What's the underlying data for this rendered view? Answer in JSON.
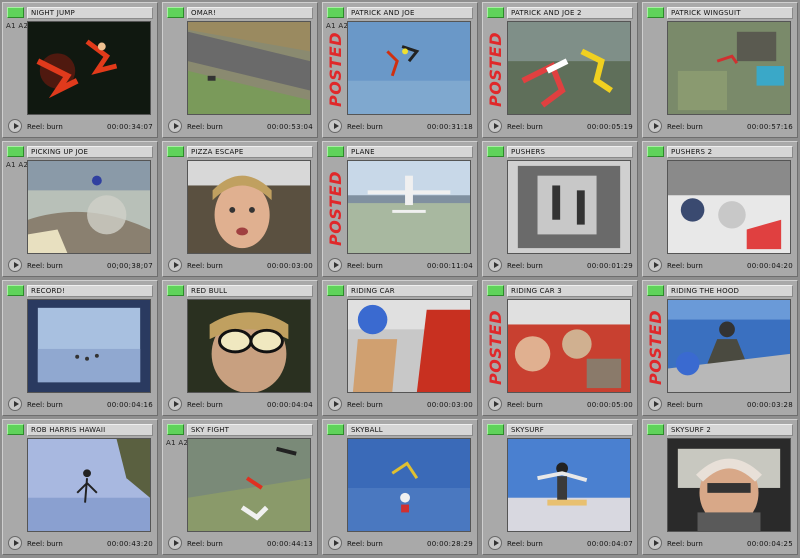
{
  "colors": {
    "background": "#8e8e8e",
    "tile": "#a9a9a9",
    "label_swatch": "#5fd35a",
    "posted_text": "#e0282a"
  },
  "clips": [
    {
      "name": "NIGHT JUMP",
      "tracks": "A1 A2",
      "posted": false,
      "reel": "Reel: burn",
      "timecode": "00:00:34:07",
      "scene": "night"
    },
    {
      "name": "OMAR!",
      "tracks": "",
      "posted": false,
      "reel": "Reel: burn",
      "timecode": "00:00:53:04",
      "scene": "road"
    },
    {
      "name": "PATRICK AND JOE",
      "tracks": "A1 A2",
      "posted": true,
      "reel": "Reel: burn",
      "timecode": "00:00:31:18",
      "scene": "sky"
    },
    {
      "name": "PATRICK AND JOE 2",
      "tracks": "",
      "posted": true,
      "reel": "Reel: burn",
      "timecode": "00:00:05:19",
      "scene": "aerial"
    },
    {
      "name": "PATRICK WINGSUIT",
      "tracks": "",
      "posted": false,
      "reel": "Reel: burn",
      "timecode": "00:00:57:16",
      "scene": "ground"
    },
    {
      "name": "PICKING UP JOE",
      "tracks": "A1 A2",
      "posted": false,
      "reel": "Reel: burn",
      "timecode": "00;00;38;07",
      "scene": "dust"
    },
    {
      "name": "PIZZA ESCAPE",
      "tracks": "",
      "posted": false,
      "reel": "Reel: burn",
      "timecode": "00:00:03:00",
      "scene": "face"
    },
    {
      "name": "PLANE",
      "tracks": "",
      "posted": true,
      "reel": "Reel: burn",
      "timecode": "00:00:11:04",
      "scene": "plane"
    },
    {
      "name": "PUSHERS",
      "tracks": "",
      "posted": false,
      "reel": "Reel: burn",
      "timecode": "00:00:01:29",
      "scene": "cabin"
    },
    {
      "name": "PUSHERS 2",
      "tracks": "",
      "posted": false,
      "reel": "Reel: burn",
      "timecode": "00:00:04:20",
      "scene": "bright"
    },
    {
      "name": "RECORD!",
      "tracks": "",
      "posted": false,
      "reel": "Reel: burn",
      "timecode": "00:00:04:16",
      "scene": "lake"
    },
    {
      "name": "RED BULL",
      "tracks": "",
      "posted": false,
      "reel": "Reel: burn",
      "timecode": "00:00:04:04",
      "scene": "goggles"
    },
    {
      "name": "RIDING CAR",
      "tracks": "",
      "posted": false,
      "reel": "Reel: burn",
      "timecode": "00:00:03:00",
      "scene": "car"
    },
    {
      "name": "RIDING CAR 3",
      "tracks": "",
      "posted": true,
      "reel": "Reel: burn",
      "timecode": "00:00:05:00",
      "scene": "car2"
    },
    {
      "name": "RIDING THE HOOD",
      "tracks": "",
      "posted": true,
      "reel": "Reel: burn",
      "timecode": "00:00:03:28",
      "scene": "hood"
    },
    {
      "name": "ROB HARRIS HAWAII",
      "tracks": "",
      "posted": false,
      "reel": "Reel: burn",
      "timecode": "00:00:43:20",
      "scene": "hawaii"
    },
    {
      "name": "SKY FIGHT",
      "tracks": "A1 A2",
      "posted": false,
      "reel": "Reel: burn",
      "timecode": "00:00:44:13",
      "scene": "fight"
    },
    {
      "name": "SKYBALL",
      "tracks": "",
      "posted": false,
      "reel": "Reel: burn",
      "timecode": "00:00:28:29",
      "scene": "skyball"
    },
    {
      "name": "SKYSURF",
      "tracks": "",
      "posted": false,
      "reel": "Reel: burn",
      "timecode": "00:00:04:07",
      "scene": "skysurf"
    },
    {
      "name": "SKYSURF 2",
      "tracks": "",
      "posted": false,
      "reel": "Reel: burn",
      "timecode": "00:00:04:25",
      "scene": "pilot"
    }
  ],
  "posted_label": "POSTED"
}
